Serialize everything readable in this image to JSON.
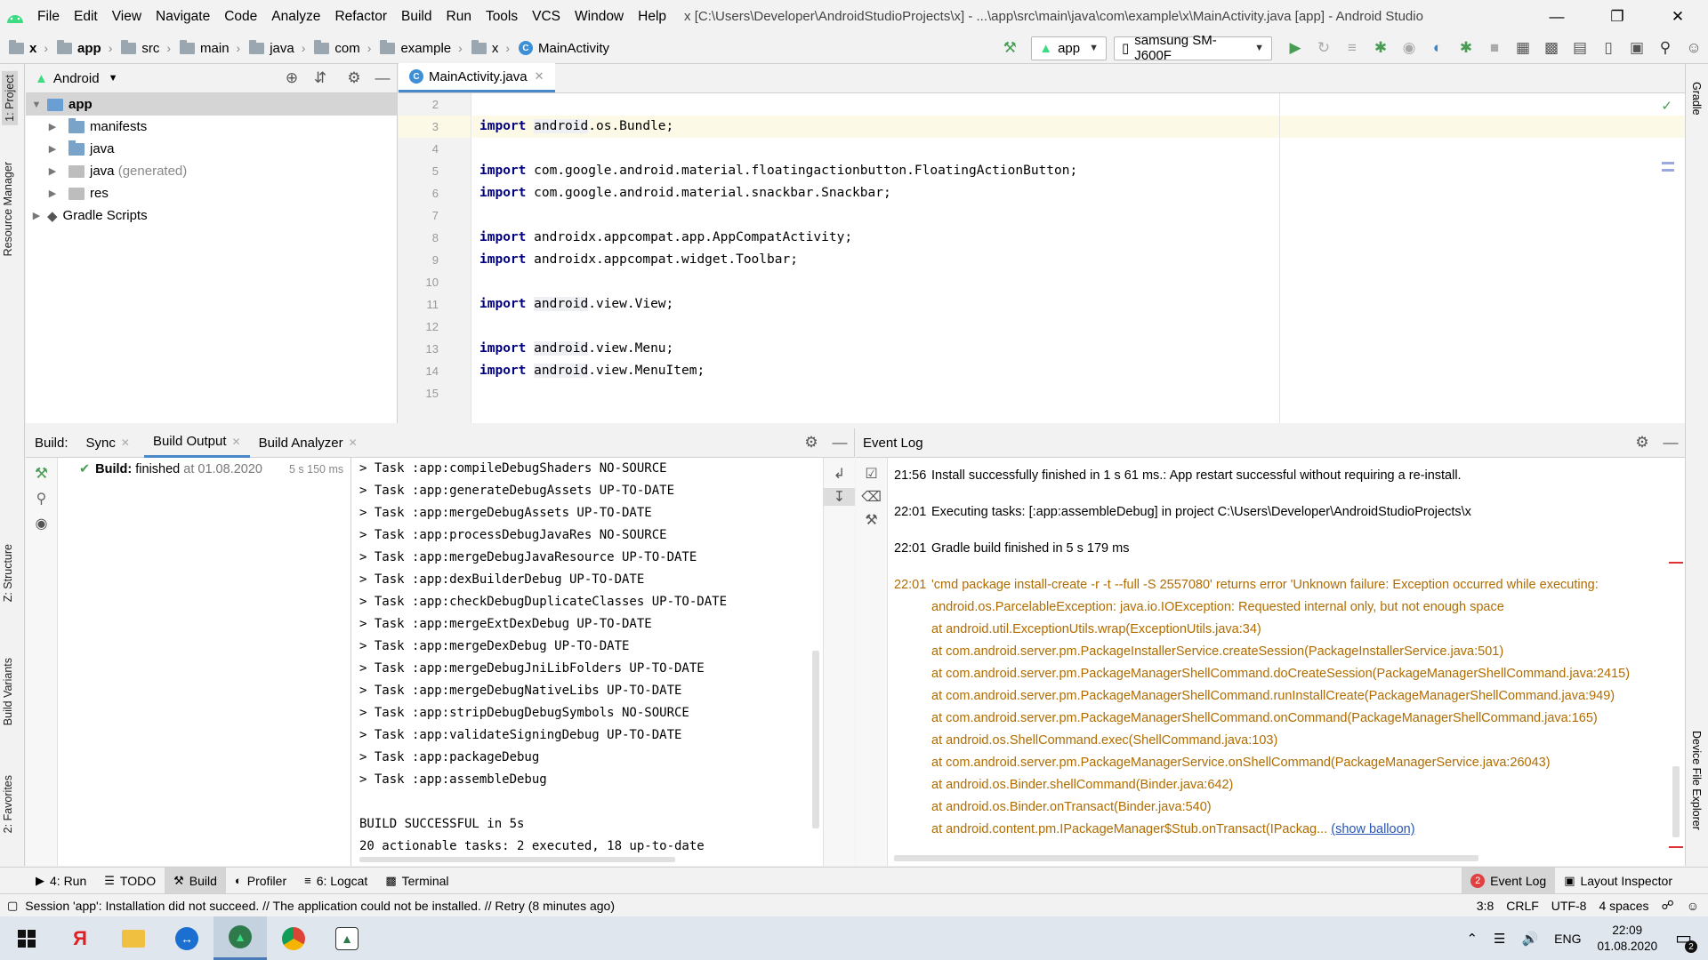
{
  "menubar": {
    "items": [
      "File",
      "Edit",
      "View",
      "Navigate",
      "Code",
      "Analyze",
      "Refactor",
      "Build",
      "Run",
      "Tools",
      "VCS",
      "Window",
      "Help"
    ],
    "title": "x [C:\\Users\\Developer\\AndroidStudioProjects\\x] - ...\\app\\src\\main\\java\\com\\example\\x\\MainActivity.java [app] - Android Studio"
  },
  "navbar": {
    "crumbs": [
      "x",
      "app",
      "src",
      "main",
      "java",
      "com",
      "example",
      "x",
      "MainActivity"
    ],
    "run_config": "app",
    "device": "samsung SM-J600F"
  },
  "left_strip": {
    "project": "1: Project",
    "resource": "Resource Manager",
    "structure": "Z: Structure",
    "variants": "Build Variants",
    "favorites": "2: Favorites"
  },
  "right_strip": {
    "gradle": "Gradle",
    "device_explorer": "Device File Explorer"
  },
  "project": {
    "view": "Android",
    "items": [
      {
        "label": "app",
        "level": 0
      },
      {
        "label": "manifests",
        "level": 1
      },
      {
        "label": "java",
        "level": 1
      },
      {
        "label": "java",
        "suffix": "(generated)",
        "level": 1
      },
      {
        "label": "res",
        "level": 1
      },
      {
        "label": "Gradle Scripts",
        "level": 0
      }
    ]
  },
  "editor": {
    "tab": "MainActivity.java",
    "line_numbers": [
      "2",
      "3",
      "4",
      "5",
      "6",
      "7",
      "8",
      "9",
      "10",
      "11",
      "12",
      "13",
      "14",
      "15"
    ],
    "lines": [
      {
        "kw": "",
        "pkg": "",
        "rest": ""
      },
      {
        "kw": "import",
        "pkg": "android",
        "rest": ".os.Bundle;"
      },
      {
        "kw": "",
        "pkg": "",
        "rest": ""
      },
      {
        "kw": "import",
        "pkg": "",
        "rest": "com.google.android.material.floatingactionbutton.FloatingActionButton;"
      },
      {
        "kw": "import",
        "pkg": "",
        "rest": "com.google.android.material.snackbar.Snackbar;"
      },
      {
        "kw": "",
        "pkg": "",
        "rest": ""
      },
      {
        "kw": "import",
        "pkg": "",
        "rest": "androidx.appcompat.app.AppCompatActivity;"
      },
      {
        "kw": "import",
        "pkg": "",
        "rest": "androidx.appcompat.widget.Toolbar;"
      },
      {
        "kw": "",
        "pkg": "",
        "rest": ""
      },
      {
        "kw": "import",
        "pkg": "android",
        "rest": ".view.View;"
      },
      {
        "kw": "",
        "pkg": "",
        "rest": ""
      },
      {
        "kw": "import",
        "pkg": "android",
        "rest": ".view.Menu;"
      },
      {
        "kw": "import",
        "pkg": "android",
        "rest": ".view.MenuItem;"
      },
      {
        "kw": "",
        "pkg": "",
        "rest": ""
      }
    ]
  },
  "build": {
    "label": "Build:",
    "tabs": [
      "Sync",
      "Build Output",
      "Build Analyzer"
    ],
    "status_bold": "Build:",
    "status": "finished",
    "status_time": "at 01.08.2020",
    "duration": "5 s 150 ms",
    "output": [
      "> Task :app:compileDebugShaders NO-SOURCE",
      "> Task :app:generateDebugAssets UP-TO-DATE",
      "> Task :app:mergeDebugAssets UP-TO-DATE",
      "> Task :app:processDebugJavaRes NO-SOURCE",
      "> Task :app:mergeDebugJavaResource UP-TO-DATE",
      "> Task :app:dexBuilderDebug UP-TO-DATE",
      "> Task :app:checkDebugDuplicateClasses UP-TO-DATE",
      "> Task :app:mergeExtDexDebug UP-TO-DATE",
      "> Task :app:mergeDexDebug UP-TO-DATE",
      "> Task :app:mergeDebugJniLibFolders UP-TO-DATE",
      "> Task :app:mergeDebugNativeLibs UP-TO-DATE",
      "> Task :app:stripDebugDebugSymbols NO-SOURCE",
      "> Task :app:validateSigningDebug UP-TO-DATE",
      "> Task :app:packageDebug",
      "> Task :app:assembleDebug",
      "",
      "BUILD SUCCESSFUL in 5s",
      "20 actionable tasks: 2 executed, 18 up-to-date"
    ]
  },
  "eventlog": {
    "title": "Event Log",
    "entries": [
      {
        "time": "21:56",
        "text": "Install successfully finished in 1 s 61 ms.: App restart successful without requiring a re-install.",
        "error": false
      },
      {
        "time": "22:01",
        "text": "Executing tasks: [:app:assembleDebug] in project C:\\Users\\Developer\\AndroidStudioProjects\\x",
        "error": false
      },
      {
        "time": "22:01",
        "text": "Gradle build finished in 5 s 179 ms",
        "error": false
      }
    ],
    "error_time": "22:01",
    "error_lines": [
      "'cmd package install-create -r -t --full -S 2557080' returns error 'Unknown failure: Exception occurred while executing:",
      "android.os.ParcelableException: java.io.IOException: Requested internal only, but not enough space",
      "at android.util.ExceptionUtils.wrap(ExceptionUtils.java:34)",
      "at com.android.server.pm.PackageInstallerService.createSession(PackageInstallerService.java:501)",
      "at com.android.server.pm.PackageManagerShellCommand.doCreateSession(PackageManagerShellCommand.java:2415)",
      "at com.android.server.pm.PackageManagerShellCommand.runInstallCreate(PackageManagerShellCommand.java:949)",
      "at com.android.server.pm.PackageManagerShellCommand.onCommand(PackageManagerShellCommand.java:165)",
      "at android.os.ShellCommand.exec(ShellCommand.java:103)",
      "at com.android.server.pm.PackageManagerService.onShellCommand(PackageManagerService.java:26043)",
      "at android.os.Binder.shellCommand(Binder.java:642)",
      "at android.os.Binder.onTransact(Binder.java:540)"
    ],
    "last_line": "at android.content.pm.IPackageManager$Stub.onTransact(IPackag...",
    "show_balloon": "(show balloon)"
  },
  "bottom_tabs": {
    "run": "4: Run",
    "todo": "TODO",
    "build": "Build",
    "profiler": "Profiler",
    "logcat": "6: Logcat",
    "terminal": "Terminal",
    "event_count": "2",
    "event_log": "Event Log",
    "layout_inspector": "Layout Inspector"
  },
  "status": {
    "message": "Session 'app': Installation did not succeed. // The application could not be installed. // Retry (8 minutes ago)",
    "pos": "3:8",
    "eol": "CRLF",
    "enc": "UTF-8",
    "indent": "4 spaces"
  },
  "taskbar": {
    "lang": "ENG",
    "time": "22:09",
    "date": "01.08.2020",
    "notif": "2"
  },
  "colors": {
    "accent": "#4a88c7",
    "error": "#b16c00",
    "keyword": "#000080"
  }
}
